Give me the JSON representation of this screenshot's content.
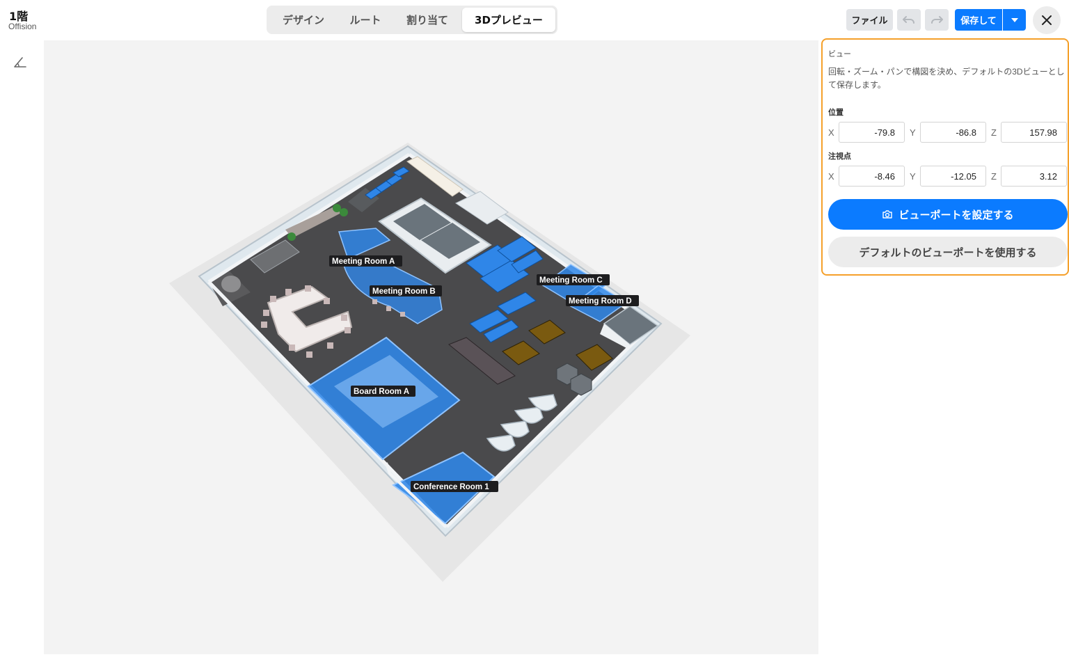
{
  "header": {
    "floor_title": "1階",
    "floor_subtitle": "Offision",
    "tabs": [
      {
        "label": "デザイン"
      },
      {
        "label": "ルート"
      },
      {
        "label": "割り当て"
      },
      {
        "label": "3Dプレビュー"
      }
    ],
    "active_tab": "3Dプレビュー",
    "file_label": "ファイル",
    "save_label": "保存して"
  },
  "panel": {
    "title": "ビュー",
    "description": "回転・ズーム・パンで構図を決め、デフォルトの3Dビューとして保存します。",
    "position_label": "位置",
    "position": {
      "x_label": "X",
      "x": "-79.8",
      "y_label": "Y",
      "y": "-86.8",
      "z_label": "Z",
      "z": "157.98"
    },
    "target_label": "注視点",
    "target": {
      "x_label": "X",
      "x": "-8.46",
      "y_label": "Y",
      "y": "-12.05",
      "z_label": "Z",
      "z": "3.12"
    },
    "set_viewport_label": "ビューポートを設定する",
    "use_default_label": "デフォルトのビューポートを使用する"
  },
  "scene": {
    "room_labels": [
      {
        "name": "Meeting Room A"
      },
      {
        "name": "Meeting Room B"
      },
      {
        "name": "Meeting Room C"
      },
      {
        "name": "Meeting Room D"
      },
      {
        "name": "Board Room A"
      },
      {
        "name": "Conference Room 1"
      }
    ],
    "colors": {
      "accent": "#0b7bff",
      "highlight": "#f5a02a",
      "room_glass": "#2f86e8",
      "floor": "#4a4a4c"
    }
  }
}
